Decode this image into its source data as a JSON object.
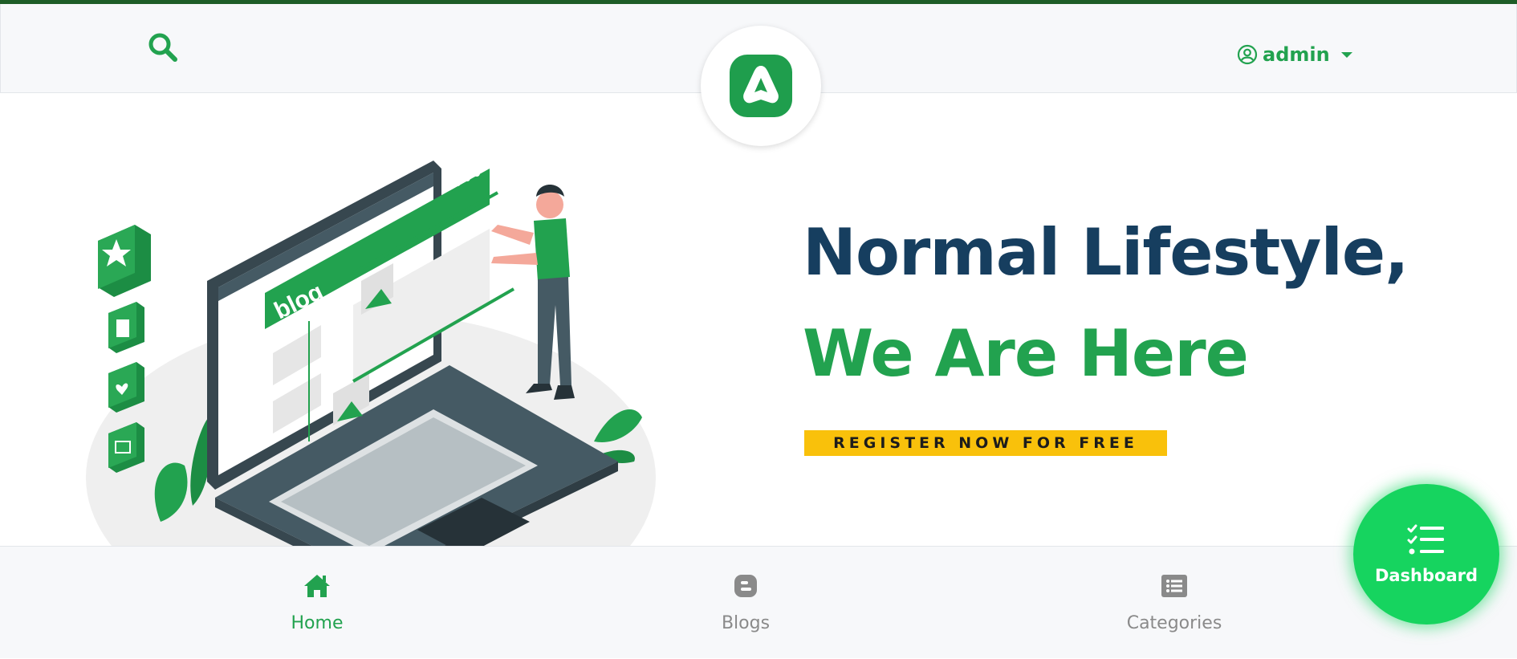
{
  "header": {
    "search_icon": "search-icon",
    "logo_icon": "app-logo-icon",
    "user": {
      "icon": "user-circle-icon",
      "name": "admin",
      "dropdown_icon": "caret-down-icon"
    }
  },
  "hero": {
    "illustration_text": "blog",
    "headline_line1": "Normal Lifestyle,",
    "headline_line2": "We Are Here",
    "cta_label": "REGISTER NOW FOR FREE"
  },
  "bottom_nav": {
    "items": [
      {
        "label": "Home",
        "icon": "home-icon",
        "active": true
      },
      {
        "label": "Blogs",
        "icon": "blogger-icon",
        "active": false
      },
      {
        "label": "Categories",
        "icon": "list-icon",
        "active": false
      }
    ]
  },
  "fab": {
    "label": "Dashboard",
    "icon": "tasks-list-icon"
  },
  "colors": {
    "brand_green": "#22a24f",
    "navy": "#163e5f",
    "accent_yellow": "#f9c10b",
    "fab_green": "#16d45f",
    "top_strip": "#1e5d27"
  }
}
